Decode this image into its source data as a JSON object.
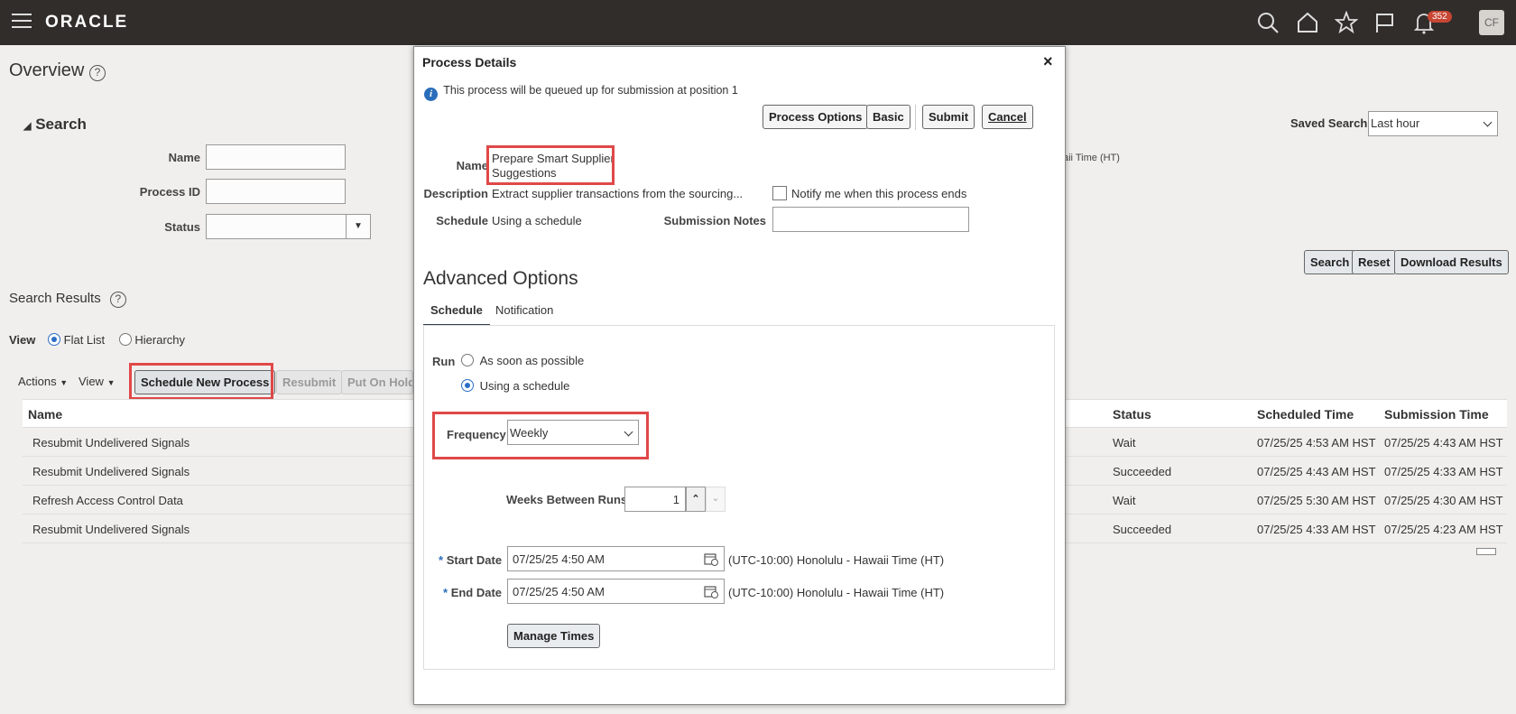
{
  "app": {
    "logo": "ORACLE",
    "notification_count": "352",
    "avatar_initials": "CF"
  },
  "page": {
    "title": "Overview",
    "help": "?"
  },
  "search": {
    "header": "Search",
    "name_label": "Name",
    "process_id_label": "Process ID",
    "status_label": "Status",
    "saved_search_label": "Saved Search",
    "saved_search_value": "Last hour",
    "truncated_tz": "aii Time (HT)",
    "search_btn": "Search",
    "reset_btn": "Reset",
    "download_btn": "Download Results"
  },
  "results": {
    "title": "Search Results",
    "view_label": "View",
    "flat_list": "Flat List",
    "hierarchy": "Hierarchy",
    "actions": "Actions",
    "view_menu": "View",
    "schedule_new": "Schedule New Process",
    "resubmit": "Resubmit",
    "put_on_hold": "Put On Hold",
    "columns": {
      "name": "Name",
      "status": "Status",
      "scheduled": "Scheduled Time",
      "submission": "Submission Time"
    },
    "rows": [
      {
        "name": "Resubmit Undelivered Signals",
        "status": "Wait",
        "scheduled": "07/25/25 4:53 AM HST",
        "submission": "07/25/25 4:43 AM HST"
      },
      {
        "name": "Resubmit Undelivered Signals",
        "status": "Succeeded",
        "scheduled": "07/25/25 4:43 AM HST",
        "submission": "07/25/25 4:33 AM HST"
      },
      {
        "name": "Refresh Access Control Data",
        "status": "Wait",
        "scheduled": "07/25/25 5:30 AM HST",
        "submission": "07/25/25 4:30 AM HST"
      },
      {
        "name": "Resubmit Undelivered Signals",
        "status": "Succeeded",
        "scheduled": "07/25/25 4:33 AM HST",
        "submission": "07/25/25 4:23 AM HST"
      }
    ]
  },
  "modal": {
    "title": "Process Details",
    "close": "×",
    "info": "This process will be queued up for submission at position 1",
    "process_options_btn": "Process Options",
    "basic_btn": "Basic",
    "submit_btn": "Submit",
    "cancel_btn": "Cancel",
    "name_label": "Name",
    "name_line1": "Prepare Smart Supplier",
    "name_line2": "Suggestions",
    "description_label": "Description",
    "description_value": "Extract supplier transactions from the sourcing...",
    "notify_label": "Notify me when this process ends",
    "schedule_label": "Schedule",
    "schedule_value": "Using a schedule",
    "submission_notes_label": "Submission Notes",
    "advanced_title": "Advanced Options",
    "tab_schedule": "Schedule",
    "tab_notification": "Notification",
    "run_label": "Run",
    "run_asap": "As soon as possible",
    "run_schedule": "Using a schedule",
    "frequency_label": "Frequency",
    "frequency_value": "Weekly",
    "weeks_label": "Weeks Between Runs",
    "weeks_value": "1",
    "required_mark": "*",
    "start_label": "Start Date",
    "start_value": "07/25/25 4:50 AM",
    "end_label": "End Date",
    "end_value": "07/25/25 4:50 AM",
    "timezone": "(UTC-10:00) Honolulu - Hawaii Time (HT)",
    "manage_times": "Manage Times"
  }
}
